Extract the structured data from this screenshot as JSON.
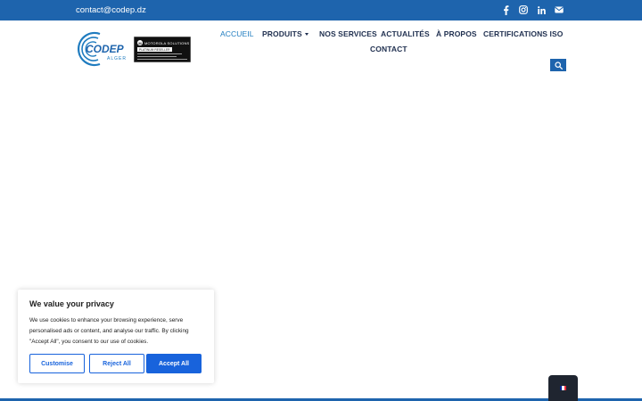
{
  "topbar": {
    "email": "contact@codep.dz",
    "social": [
      "facebook-icon",
      "instagram-icon",
      "linkedin-icon",
      "email-icon"
    ]
  },
  "logo": {
    "brand": "CODEP",
    "city": "ALGER"
  },
  "partner_badge": {
    "brand": "MOTOROLA SOLUTIONS",
    "tier": "PLATINUM RESELLER"
  },
  "nav": {
    "items": [
      "ACCUEIL",
      "PRODUITS",
      "NOS SERVICES",
      "ACTUALITÉS",
      "À PROPOS",
      "CERTIFICATIONS ISO",
      "CONTACT"
    ],
    "active": "ACCUEIL"
  },
  "search": {
    "icon": "search-icon"
  },
  "cookie": {
    "title": "We value your privacy",
    "text": "We use cookies to enhance your browsing experience, serve personalised ads or content, and analyse our traffic. By clicking \"Accept All\", you consent to our use of cookies.",
    "customise": "Customise",
    "reject": "Reject All",
    "accept": "Accept All"
  },
  "language": {
    "flag_colors": [
      "#002395",
      "#ffffff",
      "#ed2939"
    ]
  },
  "colors": {
    "brand_blue": "#1e64ad",
    "nav_active": "#1e7bbf",
    "cookie_button": "#1863dc"
  }
}
